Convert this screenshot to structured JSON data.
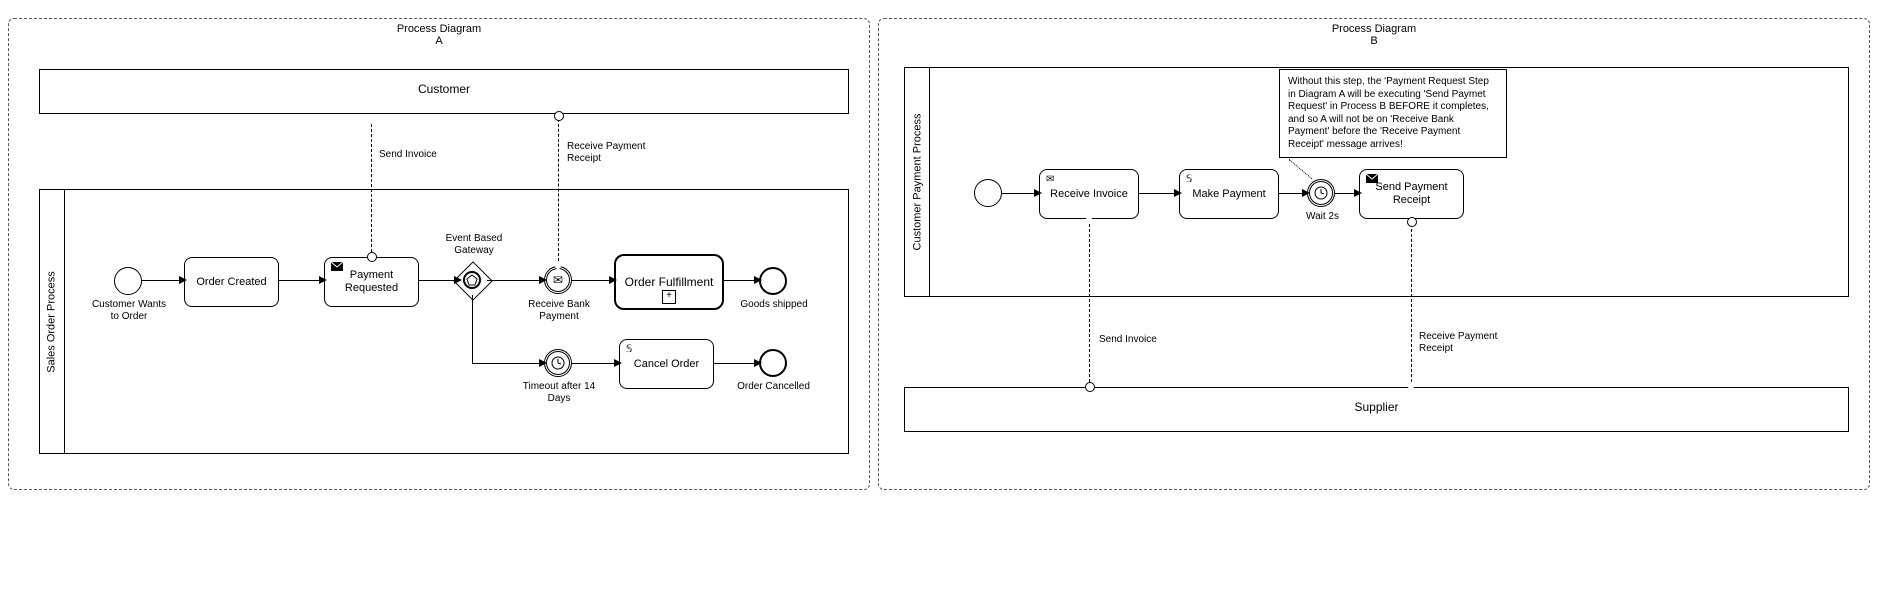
{
  "diagramA": {
    "title": "Process Diagram\nA",
    "poolCustomer": "Customer",
    "poolSales": "Sales Order Process",
    "startLabel": "Customer Wants to Order",
    "taskOrderCreated": "Order Created",
    "taskPaymentReq": "Payment Requested",
    "gatewayLabel": "Event Based Gateway",
    "msgSendInvoice": "Send Invoice",
    "msgReceivePaymentReceipt": "Receive Payment Receipt",
    "evtReceiveBank": "Receive Bank Payment",
    "evtTimeout": "Timeout after 14 Days",
    "subOrderFulfillment": "Order Fulfillment",
    "taskCancel": "Cancel Order",
    "endGoods": "Goods shipped",
    "endCancelled": "Order Cancelled"
  },
  "diagramB": {
    "title": "Process Diagram\nB",
    "poolCPP": "Customer Payment Process",
    "poolSupplier": "Supplier",
    "taskReceiveInvoice": "Receive Invoice",
    "taskMakePayment": "Make Payment",
    "evtWait": "Wait 2s",
    "taskSendReceipt": "Send Payment Receipt",
    "msgSendInvoice": "Send Invoice",
    "msgReceivePaymentReceipt": "Receive Payment Receipt",
    "note": "Without this step, the 'Payment Request Step in Diagram A will be executing 'Send Paymet Request' in Process B BEFORE it completes, and so A will not be on 'Receive Bank Payment' before the 'Receive Payment Receipt' message arrives!"
  },
  "icons": {
    "envelope": "✉",
    "script": "𝕊",
    "envelopeFilled": "envelope-filled-icon"
  }
}
